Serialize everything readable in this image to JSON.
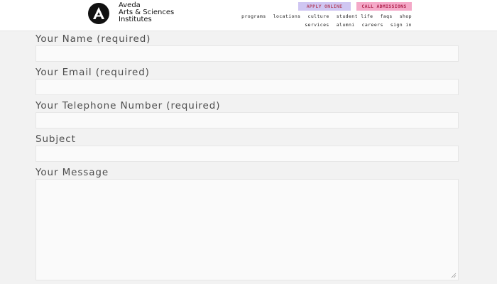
{
  "header": {
    "brand_lines": [
      "Aveda",
      "Arts & Sciences",
      "Institutes"
    ],
    "apply_label": "APPLY ONLINE",
    "call_label": "CALL ADMISSIONS",
    "nav_primary": [
      "programs",
      "locations",
      "culture",
      "student life",
      "faqs",
      "shop"
    ],
    "nav_secondary": [
      "services",
      "alumni",
      "careers",
      "sign in"
    ],
    "colors": {
      "apply_bg": "#cfc6f2",
      "call_bg": "#f4a9c8"
    }
  },
  "form": {
    "name_label": "Your Name (required)",
    "name_value": "",
    "email_label": "Your Email (required)",
    "email_value": "",
    "phone_label": "Your Telephone Number (required)",
    "phone_value": "",
    "subject_label": "Subject",
    "subject_value": "",
    "message_label": "Your Message",
    "message_value": ""
  }
}
